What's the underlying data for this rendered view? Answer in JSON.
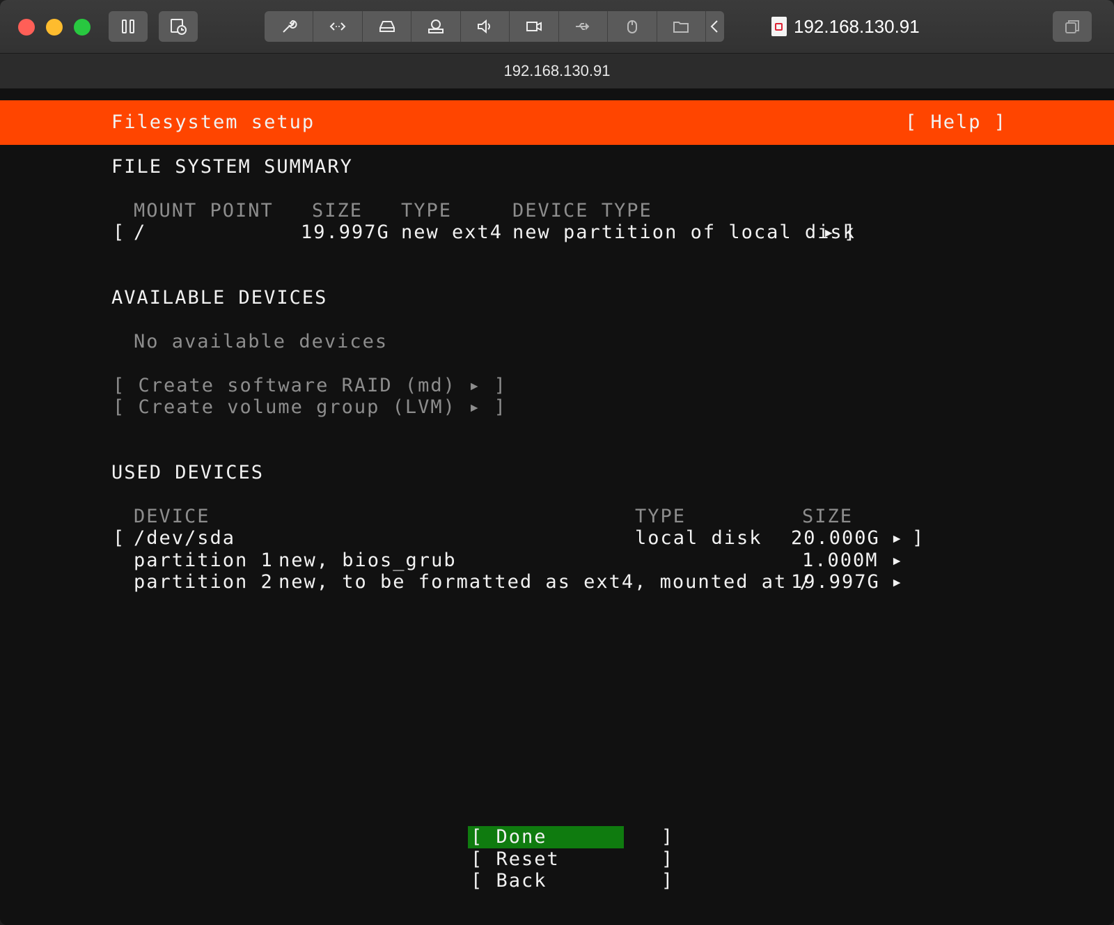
{
  "window": {
    "title": "192.168.130.91",
    "address": "192.168.130.91"
  },
  "toolbar": {
    "icons": [
      "pause-icon",
      "snapshot-icon",
      "wrench-icon",
      "code-icon",
      "disk-icon",
      "camera-icon",
      "sound-icon",
      "video-icon",
      "usb-icon",
      "mouse-icon",
      "folder-icon",
      "chevron-left-icon"
    ],
    "right_icon": "window-icon"
  },
  "colors": {
    "header": "#ff4500",
    "done_bg": "#0f7b0f",
    "background": "#111111"
  },
  "header": {
    "title": "Filesystem setup",
    "help": "[ Help ]"
  },
  "summary": {
    "heading": "FILE SYSTEM SUMMARY",
    "col_mount": "MOUNT POINT",
    "col_size": "SIZE",
    "col_type": "TYPE",
    "col_device_type": "DEVICE TYPE",
    "row_open": "[",
    "row_mount": "/",
    "row_size": "19.997G",
    "row_type": "new ext4",
    "row_device_type": "new partition of local disk",
    "row_arrow": "▸",
    "row_close": "]"
  },
  "available": {
    "heading": "AVAILABLE DEVICES",
    "none": "No available devices",
    "raid": "[ Create software RAID (md) ▸ ]",
    "lvm": "[ Create volume group (LVM) ▸ ]"
  },
  "used": {
    "heading": "USED DEVICES",
    "col_device": "DEVICE",
    "col_type": "TYPE",
    "col_size": "SIZE",
    "disk_open": "[",
    "disk_name": "/dev/sda",
    "disk_type": "local disk",
    "disk_size": "20.000G",
    "disk_arrow": "▸",
    "disk_close": "]",
    "p1_name": "partition 1",
    "p1_desc": "new, bios_grub",
    "p1_size": "1.000M",
    "p1_arrow": "▸",
    "p2_name": "partition 2",
    "p2_desc": "new, to be formatted as ext4, mounted at /",
    "p2_size": "19.997G",
    "p2_arrow": "▸"
  },
  "buttons": {
    "done": "[ Done         ]",
    "reset": "[ Reset        ]",
    "back": "[ Back         ]"
  }
}
